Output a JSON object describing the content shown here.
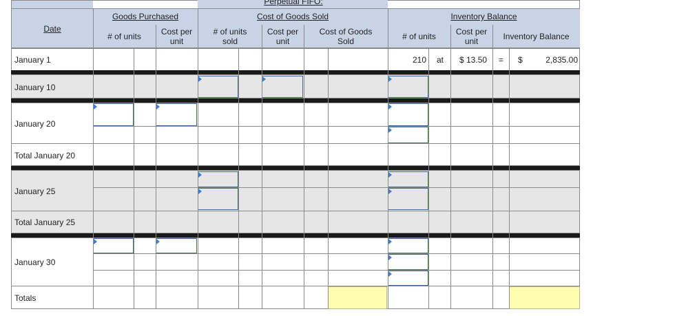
{
  "header": {
    "title": "Perpetual FIFO:",
    "groups": {
      "purchased": "Goods Purchased",
      "cogs": "Cost of Goods Sold",
      "balance": "Inventory Balance"
    },
    "columns": {
      "date": "Date",
      "p_units": "# of units",
      "p_cost": "Cost per unit",
      "s_units": "# of units sold",
      "s_cost": "Cost per unit",
      "s_total": "Cost of Goods Sold",
      "b_units": "# of units",
      "b_cost": "Cost per unit",
      "b_total": "Inventory Balance"
    }
  },
  "rows": {
    "jan1": "January 1",
    "jan10": "January 10",
    "jan20": "January 20",
    "total_jan20": "Total January 20",
    "jan25": "January 25",
    "total_jan25": "Total January 25",
    "jan30": "January 30",
    "totals": "Totals"
  },
  "jan1_balance": {
    "units": "210",
    "at": "at",
    "cost": "$ 13.50",
    "eq": "=",
    "dollar": "$",
    "total": "2,835.00"
  }
}
